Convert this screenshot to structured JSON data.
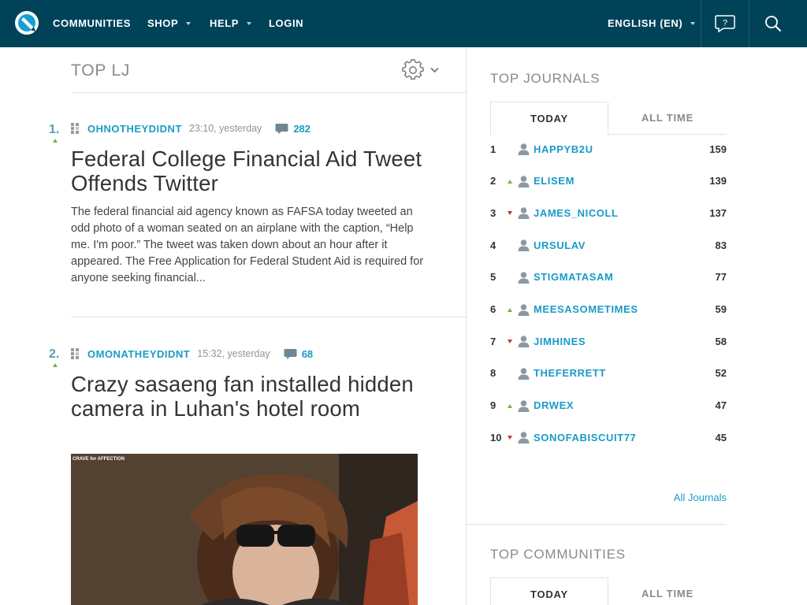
{
  "nav": {
    "items": [
      {
        "label": "COMMUNITIES",
        "caret": false
      },
      {
        "label": "SHOP",
        "caret": true
      },
      {
        "label": "HELP",
        "caret": true
      },
      {
        "label": "LOGIN",
        "caret": false
      }
    ],
    "language": "ENGLISH (EN)",
    "icons": [
      "lj-logo-icon",
      "help-icon",
      "search-icon"
    ]
  },
  "left": {
    "title": "TOP LJ",
    "posts": [
      {
        "rank": "1.",
        "journal": "OHNOTHEYDIDNT",
        "time": "23:10, yesterday",
        "comments": "282",
        "title": "Federal College Financial Aid Tweet Offends Twitter",
        "excerpt": "The federal financial aid agency known as FAFSA today tweeted an odd photo of a woman seated on an airplane with the caption, “Help me. I'm poor.” The tweet was taken down about an hour after it appeared. The Free Application for Federal Student Aid is required for anyone seeking financial..."
      },
      {
        "rank": "2.",
        "journal": "OMONATHEYDIDNT",
        "time": "15:32, yesterday",
        "comments": "68",
        "title": "Crazy sasaeng fan installed hidden camera in Luhan's hotel room",
        "image_caption": "CRAVE for AFFECTION"
      }
    ]
  },
  "right": {
    "top_journals": {
      "title": "TOP JOURNALS",
      "tabs": [
        "TODAY",
        "ALL TIME"
      ],
      "items": [
        {
          "rank": "1",
          "trend": "",
          "name": "HAPPYB2U",
          "score": "159"
        },
        {
          "rank": "2",
          "trend": "up",
          "name": "ELISEM",
          "score": "139"
        },
        {
          "rank": "3",
          "trend": "down",
          "name": "JAMES_NICOLL",
          "score": "137"
        },
        {
          "rank": "4",
          "trend": "",
          "name": "URSULAV",
          "score": "83"
        },
        {
          "rank": "5",
          "trend": "",
          "name": "STIGMATASAM",
          "score": "77"
        },
        {
          "rank": "6",
          "trend": "up",
          "name": "MEESASOMETIMES",
          "score": "59"
        },
        {
          "rank": "7",
          "trend": "down",
          "name": "JIMHINES",
          "score": "58"
        },
        {
          "rank": "8",
          "trend": "",
          "name": "THEFERRETT",
          "score": "52"
        },
        {
          "rank": "9",
          "trend": "up",
          "name": "DRWEX",
          "score": "47"
        },
        {
          "rank": "10",
          "trend": "down",
          "name": "SONOFABISCUIT77",
          "score": "45"
        }
      ],
      "all_link": "All Journals"
    },
    "top_communities": {
      "title": "TOP COMMUNITIES",
      "tabs": [
        "TODAY",
        "ALL TIME"
      ]
    }
  },
  "colors": {
    "topbar": "#004359",
    "link": "#1a9bc7",
    "trend_up": "#72b449",
    "trend_down": "#c0392b"
  }
}
